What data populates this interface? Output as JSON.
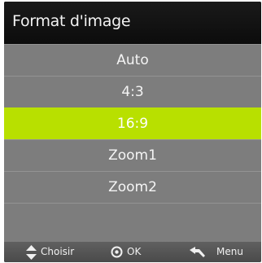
{
  "header": {
    "title": "Format d'image"
  },
  "menu": {
    "items": [
      {
        "label": "Auto",
        "selected": false
      },
      {
        "label": "4:3",
        "selected": false
      },
      {
        "label": "16:9",
        "selected": true
      },
      {
        "label": "Zoom1",
        "selected": false
      },
      {
        "label": "Zoom2",
        "selected": false
      }
    ]
  },
  "footer": {
    "choose_label": "Choisir",
    "ok_label": "OK",
    "menu_label": "Menu",
    "choose_icon": "up-down-arrows-icon",
    "ok_icon": "ok-circle-icon",
    "menu_icon": "back-arrow-icon"
  },
  "colors": {
    "highlight": "#b8e000",
    "list_background": "#7d7d7d",
    "header_background": "#111111"
  }
}
